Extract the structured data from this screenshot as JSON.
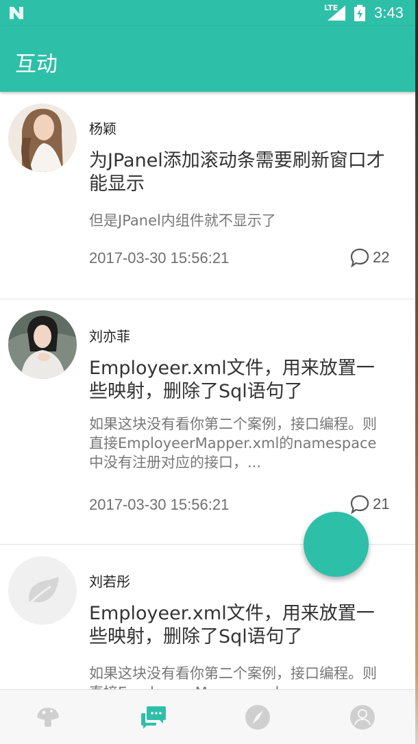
{
  "status_bar": {
    "network": "LTE",
    "time": "3:43"
  },
  "app_bar": {
    "title": "互动"
  },
  "posts": [
    {
      "author": "杨颖",
      "title": "为JPanel添加滚动条需要刷新窗口才能显示",
      "snippet": "但是JPanel内组件就不显示了",
      "date": "2017-03-30 15:56:21",
      "comment_count": "22"
    },
    {
      "author": "刘亦菲",
      "title": "Employeer.xml文件，用来放置一些映射，删除了Sql语句了",
      "snippet": "如果这块没有看你第二个案例，接口编程。则直接EmployeerMapper.xml的namespace中没有注册对应的接口，...",
      "date": "2017-03-30 15:56:21",
      "comment_count": "21"
    },
    {
      "author": "刘若彤",
      "title": "Employeer.xml文件，用来放置一些映射，删除了Sql语句了",
      "snippet": "如果这块没有看你第二个案例，接口编程。则直接EmployeerMapper.xml",
      "date": "",
      "comment_count": ""
    }
  ],
  "bottom_nav": [
    {
      "icon": "mushroom-icon",
      "active": false
    },
    {
      "icon": "chat-bubbles-icon",
      "active": true
    },
    {
      "icon": "compass-icon",
      "active": false
    },
    {
      "icon": "profile-icon",
      "active": false
    }
  ],
  "colors": {
    "primary": "#2ebfa8",
    "inactive_icon": "#cfcfcf"
  }
}
